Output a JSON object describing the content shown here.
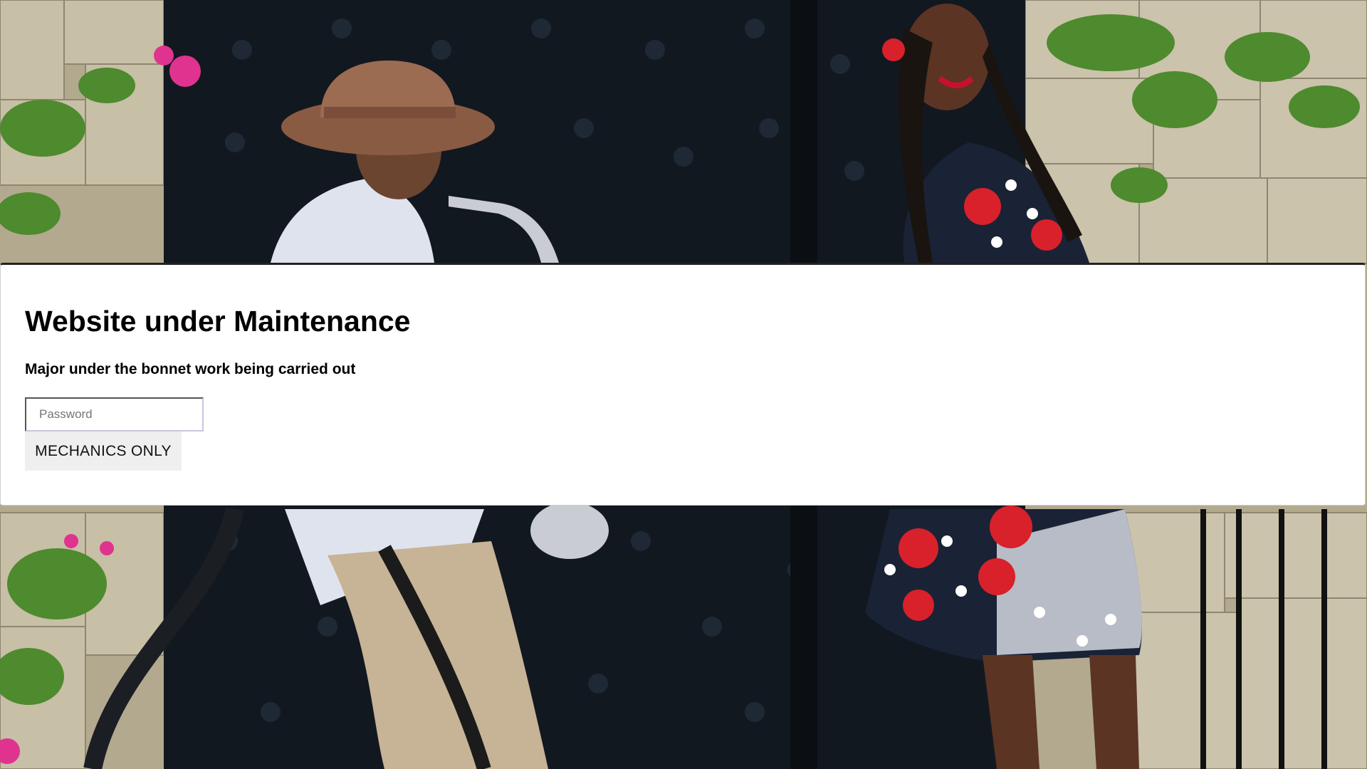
{
  "maintenance": {
    "title": "Website under Maintenance",
    "subtitle": "Major under the bonnet work being carried out",
    "password_placeholder": "Password",
    "password_value": "",
    "button_label": "MECHANICS ONLY"
  },
  "background": {
    "description_icon": "photo-background",
    "colors": {
      "stone": "#b3a98f",
      "door": "#121820",
      "hat": "#9b6b52",
      "shirt": "#dfe3ee",
      "pants": "#c7b396",
      "dress_red": "#d8212a",
      "dress_navy": "#1a2236",
      "foliage": "#4e8a2e",
      "flower_pink": "#e0338f"
    }
  }
}
